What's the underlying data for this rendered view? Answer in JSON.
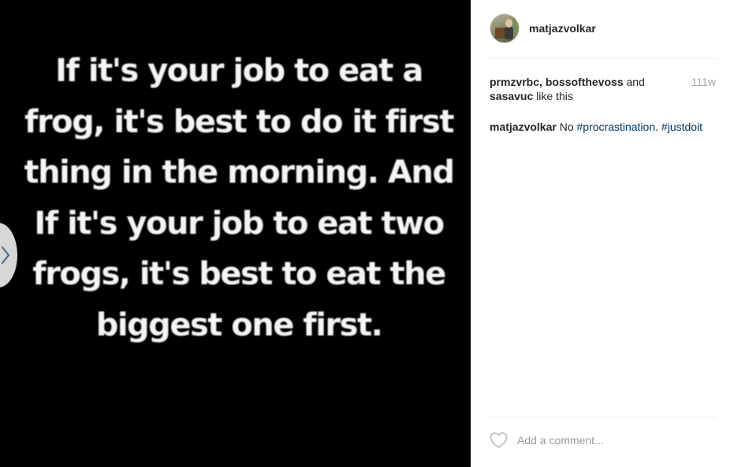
{
  "post": {
    "quote_lines": [
      "If it's your job to eat a",
      "frog, it's best to do it first",
      "thing in the morning. And",
      "If it's your job to eat two",
      "frogs, it's best to eat the",
      "biggest one first."
    ]
  },
  "nav": {
    "prev_icon": "chevron-left-icon"
  },
  "header": {
    "username": "matjazvolkar",
    "avatar_icon": "profile-photo"
  },
  "likes": {
    "names_1": "prmzvrbc",
    "sep_1": ", ",
    "names_2": "bossofthevoss",
    "sep_2": " and",
    "names_3": "sasavuc",
    "suffix": " like this",
    "age": "111w"
  },
  "caption": {
    "author": "matjazvolkar",
    "text": " No ",
    "tag_1": "#procrastination",
    "between": ". ",
    "tag_2": "#justdoit"
  },
  "comment": {
    "placeholder": "Add a comment...",
    "heart_icon": "heart-outline-icon"
  },
  "colors": {
    "link": "#003569",
    "muted": "#a5a7aa",
    "divider": "#efefef",
    "media_bg": "#000000"
  }
}
